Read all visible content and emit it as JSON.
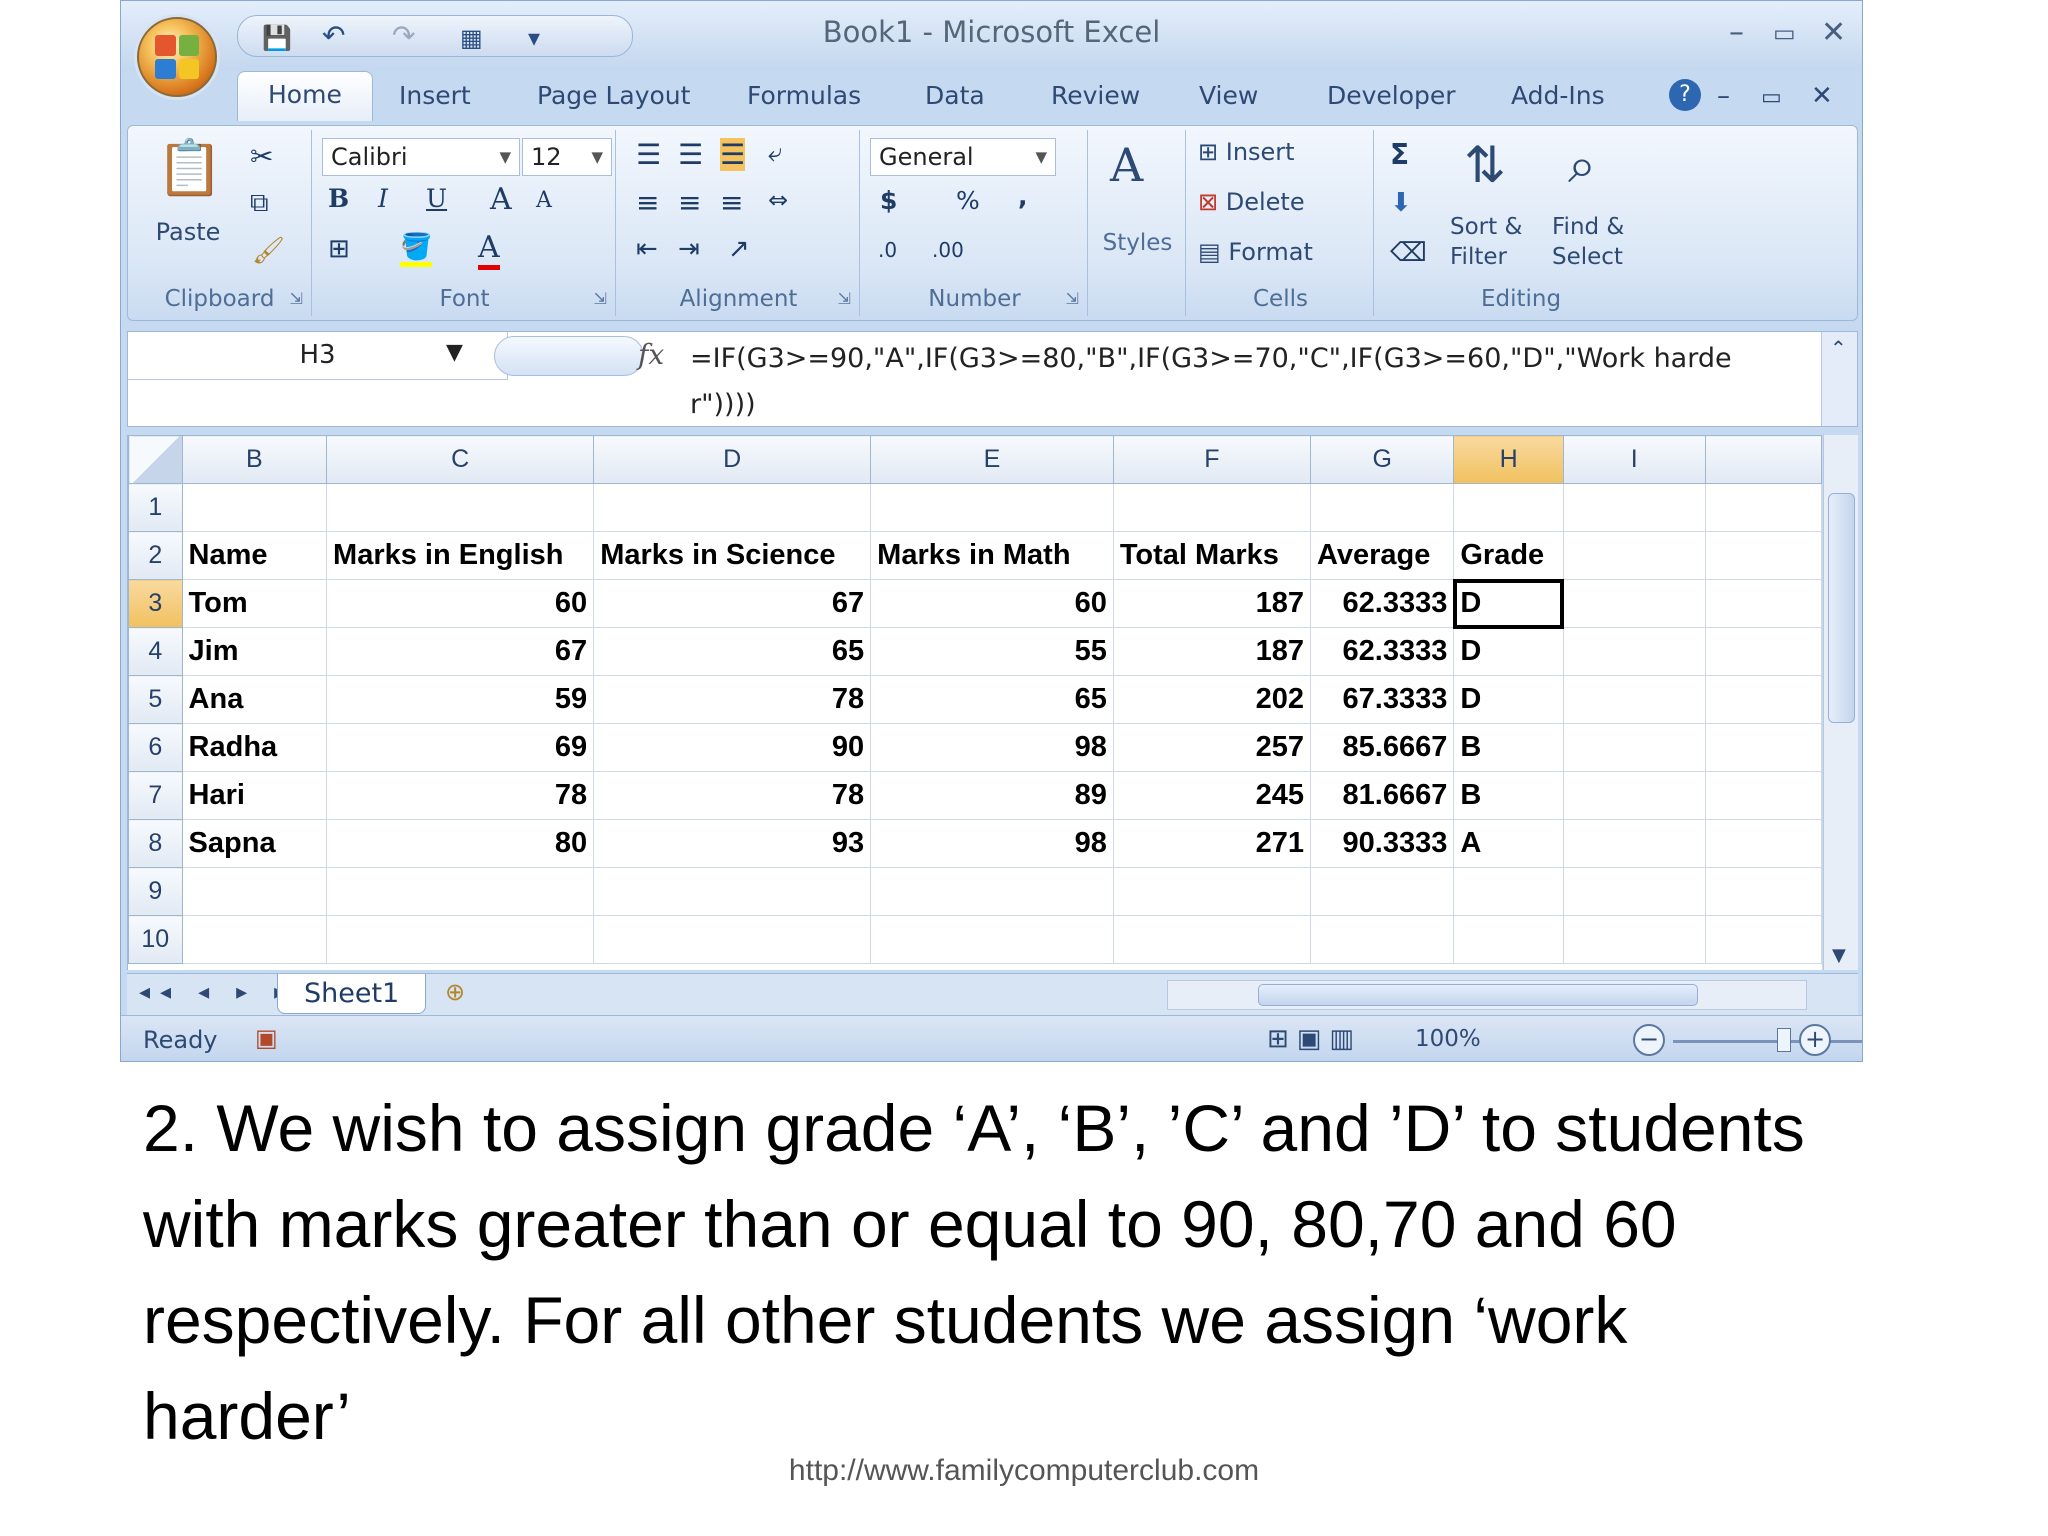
{
  "window": {
    "title": "Book1 - Microsoft Excel",
    "controls": {
      "minimize": "–",
      "maximize": "▭",
      "close": "✕"
    },
    "doc_controls": {
      "help": "?",
      "minimize": "–",
      "restore": "▭",
      "close": "✕"
    }
  },
  "quick_access": {
    "save": "💾",
    "undo": "↶",
    "redo": "↷",
    "print_preview": "▦",
    "customize": "▾"
  },
  "tabs": [
    "Home",
    "Insert",
    "Page Layout",
    "Formulas",
    "Data",
    "Review",
    "View",
    "Developer",
    "Add-Ins"
  ],
  "active_tab": "Home",
  "ribbon": {
    "clipboard": {
      "label": "Clipboard",
      "paste": "Paste"
    },
    "font": {
      "label": "Font",
      "font_name": "Calibri",
      "font_size": "12",
      "bold": "B",
      "italic": "I",
      "underline": "U",
      "grow": "A",
      "shrink": "A",
      "font_color": "A"
    },
    "alignment": {
      "label": "Alignment"
    },
    "number": {
      "label": "Number",
      "format": "General",
      "currency": "$",
      "percent": "%",
      "comma": ",",
      "inc_decimal": ".0",
      "dec_decimal": ".00"
    },
    "styles": {
      "label": "Styles"
    },
    "cells": {
      "label": "Cells",
      "insert": "Insert",
      "delete": "Delete",
      "format": "Format"
    },
    "editing": {
      "label": "Editing",
      "autosum": "Σ",
      "sort_filter_1": "Sort &",
      "sort_filter_2": "Filter",
      "find_select_1": "Find &",
      "find_select_2": "Select"
    }
  },
  "formula_bar": {
    "name_box": "H3",
    "fx": "fx",
    "formula": "=IF(G3>=90,\"A\",IF(G3>=80,\"B\",IF(G3>=70,\"C\",IF(G3>=60,\"D\",\"Work harder\")))) "
  },
  "sheet": {
    "columns": [
      "B",
      "C",
      "D",
      "E",
      "F",
      "G",
      "H",
      "I"
    ],
    "selected_column": "H",
    "selected_row": "3",
    "rows": [
      {
        "num": "1",
        "cells": [
          "",
          "",
          "",
          "",
          "",
          "",
          "",
          ""
        ]
      },
      {
        "num": "2",
        "cells": [
          "Name",
          "Marks in English",
          "Marks in Science",
          "Marks in Math",
          "Total Marks",
          "Average",
          "Grade",
          ""
        ]
      },
      {
        "num": "3",
        "cells": [
          "Tom",
          "60",
          "67",
          "60",
          "187",
          "62.3333",
          "D",
          ""
        ]
      },
      {
        "num": "4",
        "cells": [
          "Jim",
          "67",
          "65",
          "55",
          "187",
          "62.3333",
          "D",
          ""
        ]
      },
      {
        "num": "5",
        "cells": [
          "Ana",
          "59",
          "78",
          "65",
          "202",
          "67.3333",
          "D",
          ""
        ]
      },
      {
        "num": "6",
        "cells": [
          "Radha",
          "69",
          "90",
          "98",
          "257",
          "85.6667",
          "B",
          ""
        ]
      },
      {
        "num": "7",
        "cells": [
          "Hari",
          "78",
          "78",
          "89",
          "245",
          "81.6667",
          "B",
          ""
        ]
      },
      {
        "num": "8",
        "cells": [
          "Sapna",
          "80",
          "93",
          "98",
          "271",
          "90.3333",
          "A",
          ""
        ]
      },
      {
        "num": "9",
        "cells": [
          "",
          "",
          "",
          "",
          "",
          "",
          "",
          ""
        ]
      },
      {
        "num": "10",
        "cells": [
          "",
          "",
          "",
          "",
          "",
          "",
          "",
          ""
        ]
      }
    ]
  },
  "sheet_tabs": {
    "nav": "◂◂ ◂ ▸ ▸▸",
    "active": "Sheet1"
  },
  "status_bar": {
    "ready": "Ready",
    "zoom": "100%",
    "zoom_minus": "−",
    "zoom_plus": "+"
  },
  "caption": {
    "line1": "2. We wish to assign grade ‘A’, ‘B’, ’C’ and ’D’ to students",
    "line2": "with marks greater than  or equal to 90, 80,70 and 60",
    "line3": "respectively. For all other students we assign ‘work",
    "line4": "harder’"
  },
  "footer_url": "http://www.familycomputerclub.com",
  "colors": {
    "selected_header": "#f1c15f",
    "ribbon_bg": "#dbe7f6",
    "brand_orange": "#d8761c"
  }
}
